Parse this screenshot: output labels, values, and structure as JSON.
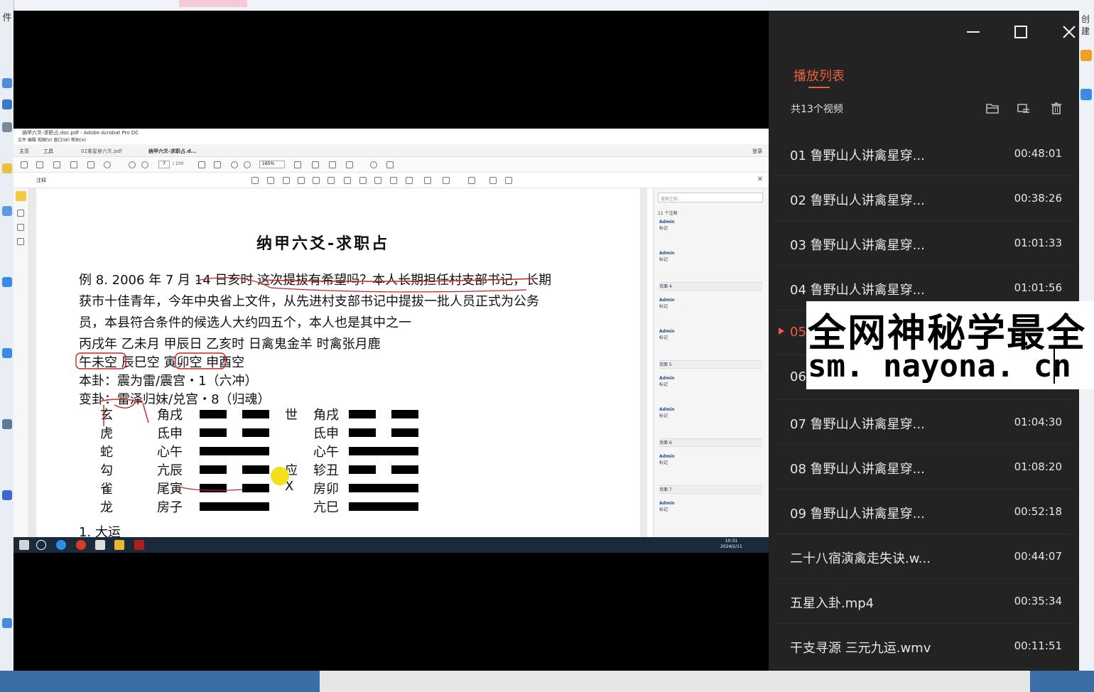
{
  "desktop": {
    "left_label": "件",
    "right_label": "创建"
  },
  "window": {
    "minimize": "minimize",
    "maximize": "maximize",
    "close": "close"
  },
  "playlist": {
    "title": "播放列表",
    "count": "共13个视频",
    "items": [
      {
        "name": "01 鲁野山人讲禽星穿...",
        "duration": "00:48:01"
      },
      {
        "name": "02 鲁野山人讲禽星穿...",
        "duration": "00:38:26"
      },
      {
        "name": "03 鲁野山人讲禽星穿...",
        "duration": "01:01:33"
      },
      {
        "name": "04 鲁野山人讲禽星穿...",
        "duration": "01:01:56"
      },
      {
        "name": "05",
        "duration": ""
      },
      {
        "name": "06",
        "duration": ""
      },
      {
        "name": "07 鲁野山人讲禽星穿...",
        "duration": "01:04:30"
      },
      {
        "name": "08 鲁野山人讲禽星穿...",
        "duration": "01:08:20"
      },
      {
        "name": "09 鲁野山人讲禽星穿...",
        "duration": "00:52:18"
      },
      {
        "name": "二十八宿演禽走失诀.w...",
        "duration": "00:44:07"
      },
      {
        "name": "五星入卦.mp4",
        "duration": "00:35:34"
      },
      {
        "name": "干支寻源 三元九运.wmv",
        "duration": "00:11:51"
      }
    ],
    "active_index": 4
  },
  "watermark": {
    "line1": "全网神秘学最全",
    "line2": "sm. nayona. cn"
  },
  "acrobat": {
    "title": "纳甲六爻-求职占.doc.pdf - Adobe Acrobat Pro DC",
    "menu": "文件  编辑  视图(V)  窗口(W)  帮助(H)",
    "tab_home": "主页",
    "tab_tools": "工具",
    "tab_doc1": "02禽星穿六爻.pdf",
    "tab_doc2": "纳甲六爻-求职占.d...",
    "signin": "登录",
    "page_num": "7",
    "page_total": "/ 100",
    "zoom": "165%",
    "comment_label": "注释",
    "search_placeholder": "搜索注释...",
    "comment_count": "11 个注释",
    "comment_author": "Admin",
    "comment_tag": "标记",
    "page_labels": [
      "页面 4",
      "页面 5",
      "页面 6",
      "页面 7"
    ],
    "time": "10:31",
    "date": "2024/2/11"
  },
  "document": {
    "title": "纳甲六爻-求职占",
    "line1": "例 8.  2006 年 7 月 14 日亥时  这次提拔有希望吗？本人长期担任村支部书记，长期",
    "line2": "获市十佳青年，今年中央省上文件，从先进村支部书记中提拔一批人员正式为公务",
    "line3": "员，本县符合条件的候选人大约四五个，本人也是其中之一",
    "line4": "丙戌年  乙未月  甲辰日  乙亥时  日禽鬼金羊  时禽张月鹿",
    "line5": "午未空  辰巳空  寅卯空  申酉空",
    "line6": "本卦：震为雷/震宫・1（六冲）",
    "line7": "变卦：雷泽归妹/兑宫・8（归魂）",
    "rows": [
      {
        "god": "玄",
        "left": "角戌",
        "mark": "世",
        "right": "角戌"
      },
      {
        "god": "虎",
        "left": "氐申",
        "mark": "",
        "right": "氐申"
      },
      {
        "god": "蛇",
        "left": "心午",
        "mark": "",
        "right": "心午"
      },
      {
        "god": "勾",
        "left": "亢辰",
        "mark": "应",
        "right": "轸丑"
      },
      {
        "god": "雀",
        "left": "尾寅",
        "mark": "X",
        "right": "房卯"
      },
      {
        "god": "龙",
        "left": "房子",
        "mark": "",
        "right": "亢巳"
      }
    ],
    "footer": "1. 大运"
  }
}
